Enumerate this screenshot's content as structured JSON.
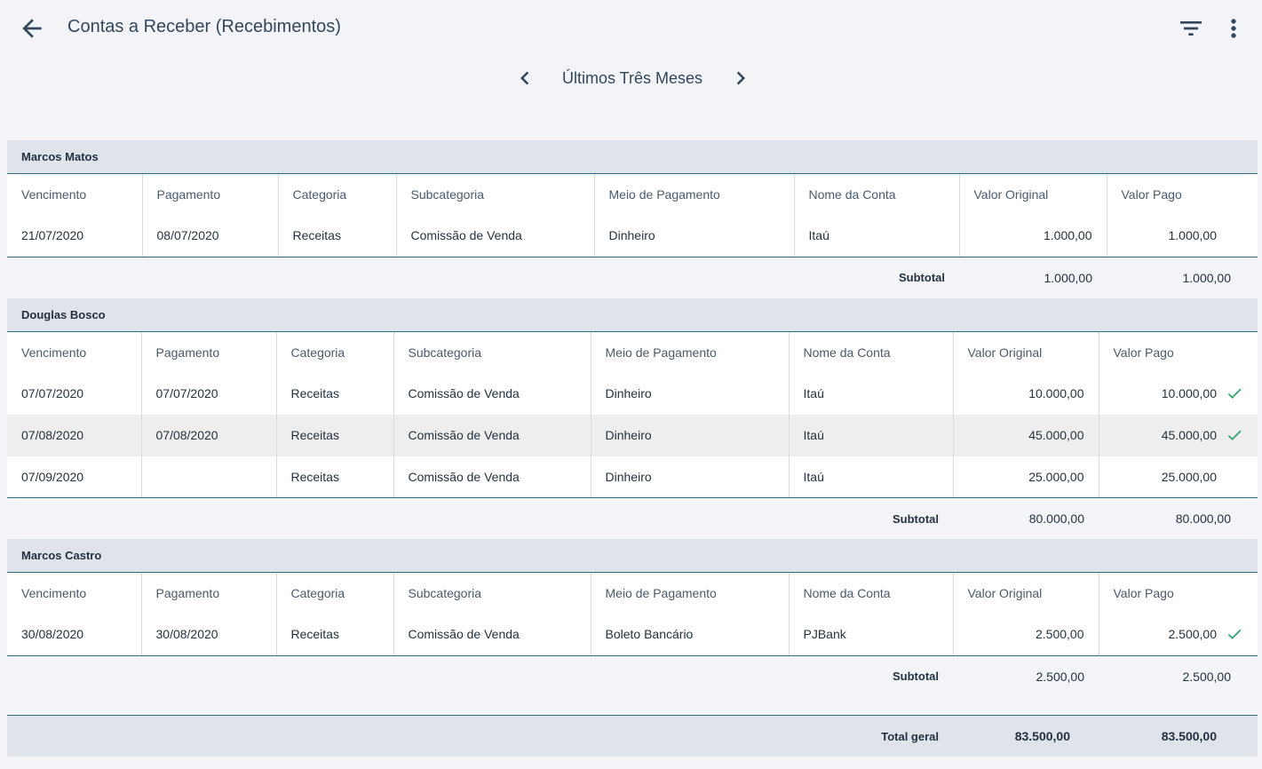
{
  "header": {
    "title": "Contas a Receber (Recebimentos)",
    "back_icon": "arrow-left-icon",
    "filter_icon": "filter-icon",
    "more_icon": "more-vert-icon"
  },
  "period": {
    "label": "Últimos Três Meses"
  },
  "columns": [
    "Vencimento",
    "Pagamento",
    "Categoria",
    "Subcategoria",
    "Meio de Pagamento",
    "Nome da Conta",
    "Valor Original",
    "Valor Pago"
  ],
  "groups": [
    {
      "name": "Marcos Matos",
      "rows": [
        {
          "vencimento": "21/07/2020",
          "pagamento": "08/07/2020",
          "categoria": "Receitas",
          "subcategoria": "Comissão de Venda",
          "meio": "Dinheiro",
          "conta": "Itaú",
          "valor_original": "1.000,00",
          "valor_pago": "1.000,00",
          "paid": false
        }
      ],
      "subtotal_label": "Subtotal",
      "subtotal_original": "1.000,00",
      "subtotal_pago": "1.000,00"
    },
    {
      "name": "Douglas Bosco",
      "rows": [
        {
          "vencimento": "07/07/2020",
          "pagamento": "07/07/2020",
          "categoria": "Receitas",
          "subcategoria": "Comissão de Venda",
          "meio": "Dinheiro",
          "conta": "Itaú",
          "valor_original": "10.000,00",
          "valor_pago": "10.000,00",
          "paid": true
        },
        {
          "vencimento": "07/08/2020",
          "pagamento": "07/08/2020",
          "categoria": "Receitas",
          "subcategoria": "Comissão de Venda",
          "meio": "Dinheiro",
          "conta": "Itaú",
          "valor_original": "45.000,00",
          "valor_pago": "45.000,00",
          "paid": true
        },
        {
          "vencimento": "07/09/2020",
          "pagamento": "",
          "categoria": "Receitas",
          "subcategoria": "Comissão de Venda",
          "meio": "Dinheiro",
          "conta": "Itaú",
          "valor_original": "25.000,00",
          "valor_pago": "25.000,00",
          "paid": false
        }
      ],
      "subtotal_label": "Subtotal",
      "subtotal_original": "80.000,00",
      "subtotal_pago": "80.000,00"
    },
    {
      "name": "Marcos Castro",
      "rows": [
        {
          "vencimento": "30/08/2020",
          "pagamento": "30/08/2020",
          "categoria": "Receitas",
          "subcategoria": "Comissão de Venda",
          "meio": "Boleto Bancário",
          "conta": "PJBank",
          "valor_original": "2.500,00",
          "valor_pago": "2.500,00",
          "paid": true
        }
      ],
      "subtotal_label": "Subtotal",
      "subtotal_original": "2.500,00",
      "subtotal_pago": "2.500,00"
    }
  ],
  "grand_total": {
    "label": "Total geral",
    "original": "83.500,00",
    "pago": "83.500,00"
  },
  "colors": {
    "accent": "#2f6a84",
    "check": "#2e9e6b",
    "header_bg": "#dfe3ea",
    "page_bg": "#f2f4f7"
  }
}
